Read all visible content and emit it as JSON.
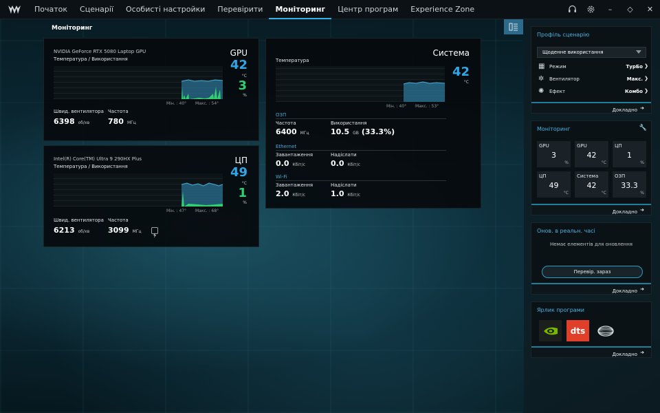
{
  "nav": {
    "items": [
      "Початок",
      "Сценарії",
      "Особисті настройки",
      "Перевірити",
      "Моніторинг",
      "Центр програм",
      "Experience Zone"
    ],
    "active_index": 4
  },
  "window": {
    "minimize": "–",
    "maximize": "◇",
    "close": "✕"
  },
  "page_title": "Моніторинг",
  "gpu": {
    "name": "NVIDIA GeForce RTX 5080 Laptop GPU",
    "subtitle": "Температура / Використання",
    "label": "GPU",
    "temp": "42",
    "temp_unit": "°C",
    "usage": "3",
    "usage_unit": "%",
    "min": "Мін. : 40°",
    "max": "Макс. : 54°",
    "fan_label": "Швид. вентилятора",
    "fan_value": "6398",
    "fan_unit": "об/хв",
    "freq_label": "Частота",
    "freq_value": "780",
    "freq_unit": "МГц"
  },
  "cpu": {
    "name": "Intel(R) Core(TM) Ultra 9 290HX Plus",
    "subtitle": "Температура / Використання",
    "label": "ЦП",
    "temp": "49",
    "temp_unit": "°C",
    "usage": "1",
    "usage_unit": "%",
    "min": "Мін. : 47°",
    "max": "Макс. : 68°",
    "fan_label": "Швид. вентилятора",
    "fan_value": "6213",
    "fan_unit": "об/хв",
    "freq_label": "Частота",
    "freq_value": "3099",
    "freq_unit": "МГц"
  },
  "system": {
    "label": "Система",
    "temp_label": "Температура",
    "temp": "42",
    "temp_unit": "°C",
    "min": "Мін. : 40°",
    "max": "Макс. : 53°",
    "ram": {
      "title": "ОЗП",
      "freq_label": "Частота",
      "freq_value": "6400",
      "freq_unit": "МГц",
      "use_label": "Використання",
      "use_value": "10.5",
      "use_unit": "GB",
      "use_pct": "(33.3%)"
    },
    "ethernet": {
      "title": "Ethernet",
      "down_label": "Завантаження",
      "down_value": "0.0",
      "down_unit": "Кбіт/с",
      "up_label": "Надіслати",
      "up_value": "0.0",
      "up_unit": "Кбіт/с"
    },
    "wifi": {
      "title": "Wi-Fi",
      "down_label": "Завантаження",
      "down_value": "2.0",
      "down_unit": "Кбіт/с",
      "up_label": "Надіслати",
      "up_value": "1.0",
      "up_unit": "Кбіт/с"
    }
  },
  "profile": {
    "title": "Профіль сценарію",
    "selected": "Щоденне використання",
    "rows": [
      {
        "label": "Режим",
        "value": "ТурБо"
      },
      {
        "label": "Вентилятор",
        "value": "Макс."
      },
      {
        "label": "Ефект",
        "value": "Комбо"
      }
    ],
    "more": "Докладно"
  },
  "monitor_card": {
    "title": "Моніторинг",
    "tiles": [
      {
        "label": "GPU",
        "value": "3",
        "unit": "%"
      },
      {
        "label": "GPU",
        "value": "42",
        "unit": "°C"
      },
      {
        "label": "ЦП",
        "value": "1",
        "unit": "%"
      },
      {
        "label": "ЦП",
        "value": "49",
        "unit": "°C"
      },
      {
        "label": "Система",
        "value": "42",
        "unit": "°C"
      },
      {
        "label": "ОЗП",
        "value": "33.3",
        "unit": "%"
      }
    ],
    "more": "Докладно"
  },
  "realtime": {
    "title": "Онов. в реальн. часі",
    "message": "Немає елементів для оновлення",
    "button": "Перевір. зараз",
    "more": "Докладно"
  },
  "shortcuts": {
    "title": "Ярлик програми",
    "dts_text": "dts",
    "more": "Докладно"
  },
  "colors": {
    "accent": "#2fb2e6",
    "temp": "#2fa8e8",
    "usage": "#30d070"
  }
}
